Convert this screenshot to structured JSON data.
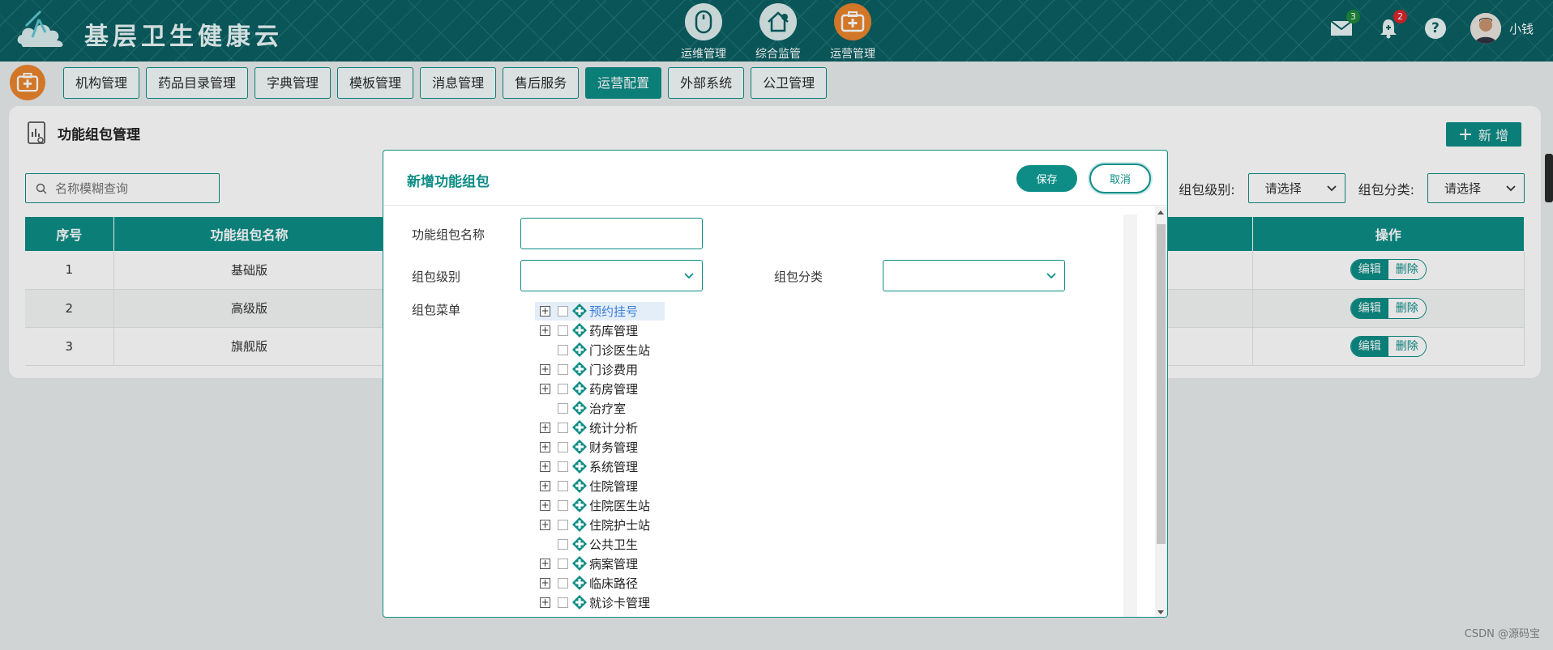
{
  "header": {
    "app_title": "基层卫生健康云",
    "modules": [
      {
        "label": "运维管理",
        "icon": "mouse-icon"
      },
      {
        "label": "综合监管",
        "icon": "home-settings-icon"
      },
      {
        "label": "运营管理",
        "icon": "medical-case-icon"
      }
    ],
    "mail_count": "3",
    "notify_count": "2",
    "user_name": "小钱"
  },
  "tabs": [
    "机构管理",
    "药品目录管理",
    "字典管理",
    "模板管理",
    "消息管理",
    "售后服务",
    "运营配置",
    "外部系统",
    "公卫管理"
  ],
  "active_tab": "运营配置",
  "page": {
    "title": "功能组包管理",
    "new_button": "新 增",
    "search_placeholder": "名称模糊查询",
    "filter_level_label": "组包级别:",
    "filter_level_value": "请选择",
    "filter_category_label": "组包分类:",
    "filter_category_value": "请选择"
  },
  "table": {
    "headers": {
      "index": "序号",
      "name": "功能组包名称",
      "ops": "操作"
    },
    "rows": [
      {
        "index": "1",
        "name": "基础版"
      },
      {
        "index": "2",
        "name": "高级版"
      },
      {
        "index": "3",
        "name": "旗舰版"
      }
    ],
    "edit_label": "编辑",
    "delete_label": "删除"
  },
  "modal": {
    "title": "新增功能组包",
    "save": "保存",
    "cancel": "取消",
    "name_label": "功能组包名称",
    "level_label": "组包级别",
    "category_label": "组包分类",
    "menu_label": "组包菜单",
    "tree": [
      {
        "label": "预约挂号",
        "expandable": true,
        "highlight": true
      },
      {
        "label": "药库管理",
        "expandable": true
      },
      {
        "label": "门诊医生站",
        "expandable": false
      },
      {
        "label": "门诊费用",
        "expandable": true
      },
      {
        "label": "药房管理",
        "expandable": true
      },
      {
        "label": "治疗室",
        "expandable": false
      },
      {
        "label": "统计分析",
        "expandable": true
      },
      {
        "label": "财务管理",
        "expandable": true
      },
      {
        "label": "系统管理",
        "expandable": true
      },
      {
        "label": "住院管理",
        "expandable": true
      },
      {
        "label": "住院医生站",
        "expandable": true
      },
      {
        "label": "住院护士站",
        "expandable": true
      },
      {
        "label": "公共卫生",
        "expandable": false
      },
      {
        "label": "病案管理",
        "expandable": true
      },
      {
        "label": "临床路径",
        "expandable": true
      },
      {
        "label": "就诊卡管理",
        "expandable": true
      }
    ]
  },
  "watermark": "CSDN @源码宝",
  "colors": {
    "primary": "#0d8d86",
    "header": "#0b5f62",
    "accent": "#e9852c"
  }
}
